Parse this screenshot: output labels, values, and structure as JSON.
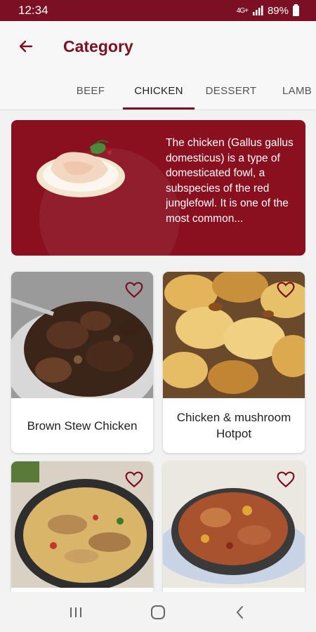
{
  "status": {
    "time": "12:34",
    "network": "4G+",
    "battery": "89%"
  },
  "appbar": {
    "title": "Category"
  },
  "tabs": [
    {
      "label": "BEEF",
      "active": false
    },
    {
      "label": "CHICKEN",
      "active": true
    },
    {
      "label": "DESSERT",
      "active": false
    },
    {
      "label": "LAMB",
      "active": false
    }
  ],
  "banner": {
    "description": "The chicken (Gallus gallus domesticus) is a type of domesticated fowl, a subspecies of the red junglefowl. It is one of the most common..."
  },
  "meals": [
    {
      "name": "Brown Stew Chicken",
      "favorite": false
    },
    {
      "name": "Chicken & mushroom Hotpot",
      "favorite": false
    },
    {
      "name": "",
      "favorite": false
    },
    {
      "name": "",
      "favorite": false
    }
  ],
  "colors": {
    "primary": "#7b0f24",
    "banner": "#8a1020"
  },
  "icons": {
    "back": "arrow-left-icon",
    "favorite": "heart-outline-icon",
    "nav_recents": "recents-icon",
    "nav_home": "home-icon",
    "nav_back": "back-chevron-icon"
  }
}
